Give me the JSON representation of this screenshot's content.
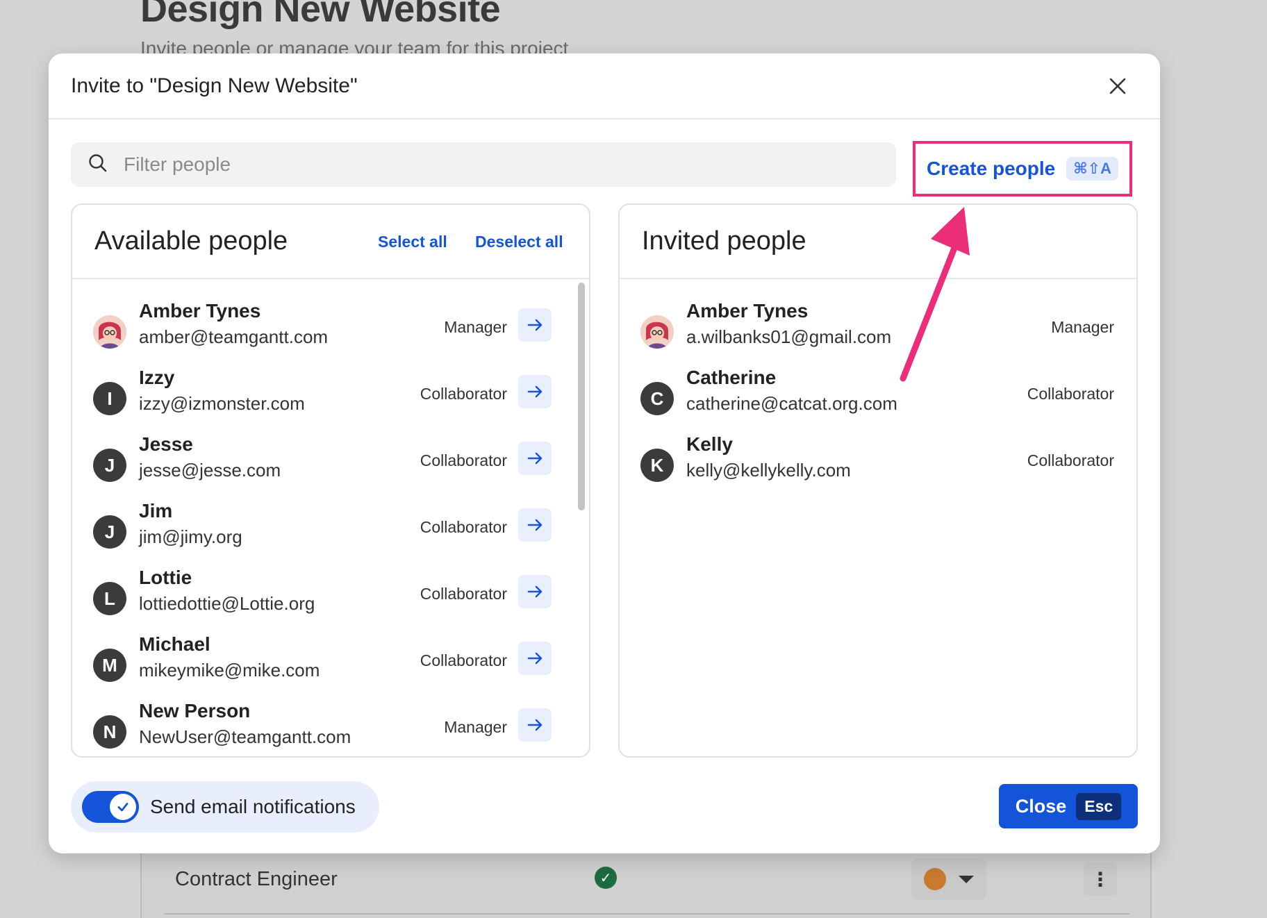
{
  "background": {
    "title": "Design New Website",
    "subtitle": "Invite people or manage your team for this project",
    "row_label": "Contract Engineer"
  },
  "modal": {
    "title": "Invite to \"Design New Website\"",
    "search_placeholder": "Filter people",
    "create_label": "Create people",
    "create_shortcut": "⌘⇧A",
    "available": {
      "title": "Available people",
      "select_all": "Select all",
      "deselect_all": "Deselect all",
      "people": [
        {
          "name": "Amber Tynes",
          "email": "amber@teamgantt.com",
          "role": "Manager",
          "initial": "",
          "photo": true
        },
        {
          "name": "Izzy",
          "email": "izzy@izmonster.com",
          "role": "Collaborator",
          "initial": "I"
        },
        {
          "name": "Jesse",
          "email": "jesse@jesse.com",
          "role": "Collaborator",
          "initial": "J"
        },
        {
          "name": "Jim",
          "email": "jim@jimy.org",
          "role": "Collaborator",
          "initial": "J"
        },
        {
          "name": "Lottie",
          "email": "lottiedottie@Lottie.org",
          "role": "Collaborator",
          "initial": "L"
        },
        {
          "name": "Michael",
          "email": "mikeymike@mike.com",
          "role": "Collaborator",
          "initial": "M"
        },
        {
          "name": "New Person",
          "email": "NewUser@teamgantt.com",
          "role": "Manager",
          "initial": "N"
        }
      ]
    },
    "invited": {
      "title": "Invited people",
      "people": [
        {
          "name": "Amber Tynes",
          "email": "a.wilbanks01@gmail.com",
          "role": "Manager",
          "initial": "",
          "photo": true
        },
        {
          "name": "Catherine",
          "email": "catherine@catcat.org.com",
          "role": "Collaborator",
          "initial": "C"
        },
        {
          "name": "Kelly",
          "email": "kelly@kellykelly.com",
          "role": "Collaborator",
          "initial": "K"
        }
      ]
    },
    "notifications_label": "Send email notifications",
    "notifications_on": true,
    "close_label": "Close",
    "close_shortcut": "Esc"
  },
  "colors": {
    "accent": "#1354d8",
    "highlight": "#ec2e7a"
  }
}
